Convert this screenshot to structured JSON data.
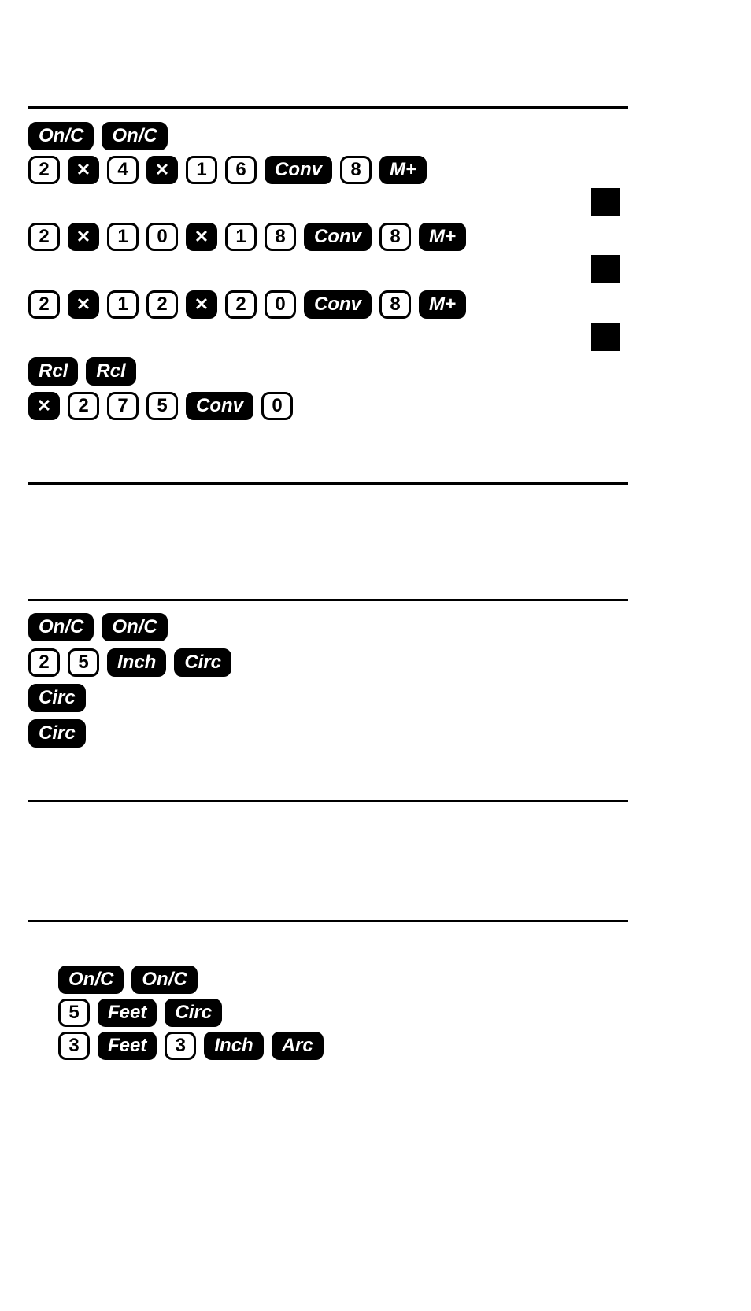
{
  "section1": {
    "row1": [
      "On/C",
      "On/C"
    ],
    "row2": [
      {
        "t": "2",
        "s": "white"
      },
      {
        "t": "✕",
        "s": "icon"
      },
      {
        "t": "4",
        "s": "white"
      },
      {
        "t": "✕",
        "s": "icon"
      },
      {
        "t": "1",
        "s": "white"
      },
      {
        "t": "6",
        "s": "white"
      },
      {
        "t": "Conv",
        "s": "black"
      },
      {
        "t": "8",
        "s": "white"
      },
      {
        "t": "M+",
        "s": "black"
      }
    ],
    "row3": [
      {
        "t": "2",
        "s": "white"
      },
      {
        "t": "✕",
        "s": "icon"
      },
      {
        "t": "1",
        "s": "white"
      },
      {
        "t": "0",
        "s": "white"
      },
      {
        "t": "✕",
        "s": "icon"
      },
      {
        "t": "1",
        "s": "white"
      },
      {
        "t": "8",
        "s": "white"
      },
      {
        "t": "Conv",
        "s": "black"
      },
      {
        "t": "8",
        "s": "white"
      },
      {
        "t": "M+",
        "s": "black"
      }
    ],
    "row4": [
      {
        "t": "2",
        "s": "white"
      },
      {
        "t": "✕",
        "s": "icon"
      },
      {
        "t": "1",
        "s": "white"
      },
      {
        "t": "2",
        "s": "white"
      },
      {
        "t": "✕",
        "s": "icon"
      },
      {
        "t": "2",
        "s": "white"
      },
      {
        "t": "0",
        "s": "white"
      },
      {
        "t": "Conv",
        "s": "black"
      },
      {
        "t": "8",
        "s": "white"
      },
      {
        "t": "M+",
        "s": "black"
      }
    ],
    "row5": [
      {
        "t": "Rcl",
        "s": "black"
      },
      {
        "t": "Rcl",
        "s": "black"
      }
    ],
    "row6": [
      {
        "t": "✕",
        "s": "icon"
      },
      {
        "t": "2",
        "s": "white"
      },
      {
        "t": "7",
        "s": "white"
      },
      {
        "t": "5",
        "s": "white"
      },
      {
        "t": "Conv",
        "s": "black"
      },
      {
        "t": "0",
        "s": "white"
      }
    ]
  },
  "section2": {
    "row1": [
      "On/C",
      "On/C"
    ],
    "row2": [
      {
        "t": "2",
        "s": "white"
      },
      {
        "t": "5",
        "s": "white"
      },
      {
        "t": "Inch",
        "s": "black"
      },
      {
        "t": "Circ",
        "s": "black"
      }
    ],
    "row3": [
      {
        "t": "Circ",
        "s": "black"
      }
    ],
    "row4": [
      {
        "t": "Circ",
        "s": "black"
      }
    ]
  },
  "section3": {
    "row1": [
      "On/C",
      "On/C"
    ],
    "row2": [
      {
        "t": "5",
        "s": "white"
      },
      {
        "t": "Feet",
        "s": "black"
      },
      {
        "t": "Circ",
        "s": "black"
      }
    ],
    "row3": [
      {
        "t": "3",
        "s": "white"
      },
      {
        "t": "Feet",
        "s": "black"
      },
      {
        "t": "3",
        "s": "white"
      },
      {
        "t": "Inch",
        "s": "black"
      },
      {
        "t": "Arc",
        "s": "black"
      }
    ]
  }
}
